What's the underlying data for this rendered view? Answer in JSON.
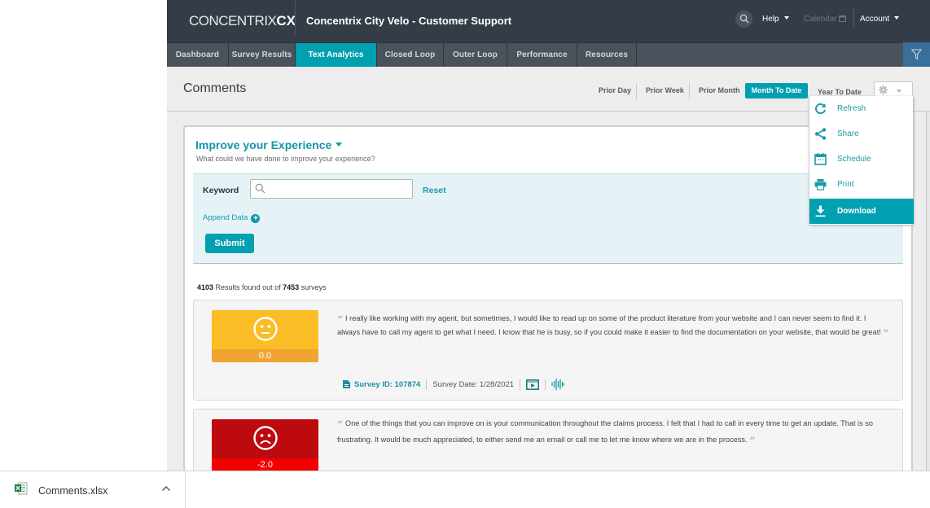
{
  "header": {
    "logo_main": "CONCENTRIX",
    "logo_suffix": "CX",
    "app_title": "Concentrix City Velo - Customer Support",
    "help_label": "Help",
    "calendar_label": "Calendar",
    "account_label": "Account"
  },
  "tabs": [
    {
      "label": "Dashboard",
      "active": false
    },
    {
      "label": "Survey Results",
      "active": false
    },
    {
      "label": "Text Analytics",
      "active": true
    },
    {
      "label": "Closed Loop",
      "active": false
    },
    {
      "label": "Outer Loop",
      "active": false
    },
    {
      "label": "Performance",
      "active": false
    },
    {
      "label": "Resources",
      "active": false
    }
  ],
  "page": {
    "title": "Comments",
    "periods": [
      {
        "label": "Prior Day",
        "active": false
      },
      {
        "label": "Prior Week",
        "active": false
      },
      {
        "label": "Prior Month",
        "active": false
      },
      {
        "label": "Month To Date",
        "active": true
      },
      {
        "label": "Year To Date",
        "active": false
      }
    ]
  },
  "settings_menu": {
    "items": [
      {
        "label": "Refresh",
        "icon": "refresh-icon",
        "active": false
      },
      {
        "label": "Share",
        "icon": "share-icon",
        "active": false
      },
      {
        "label": "Schedule",
        "icon": "calendar-icon",
        "active": false
      },
      {
        "label": "Print",
        "icon": "printer-icon",
        "active": false
      },
      {
        "label": "Download",
        "icon": "download-icon",
        "active": true
      }
    ]
  },
  "question": {
    "title": "Improve your Experience",
    "subtitle": "What could we have done to improve your experience?"
  },
  "filters": {
    "keyword_label": "Keyword",
    "keyword_value": "",
    "keyword_placeholder": "",
    "reset_label": "Reset",
    "append_label": "Append Data",
    "submit_label": "Submit"
  },
  "results": {
    "found": "4103",
    "found_text": " Results found out of ",
    "total": "7453",
    "total_text": " surveys"
  },
  "comments": [
    {
      "score": "0.0",
      "sentiment": "neutral",
      "face_color": "#fbbd26",
      "bar_color": "#f0a432",
      "text": "I really like working with my agent, but sometimes, I would like to read up on some of the product literature from your website and I can never seem to find it. I always have to call my agent to get what I need. I know that he is busy, so if you could make it easier to find the documentation on your website, that would be great!",
      "survey_id_label": "Survey ID: 107874",
      "survey_date_label": "Survey Date: 1/28/2021"
    },
    {
      "score": "-2.0",
      "sentiment": "negative",
      "face_color": "#bd0a0e",
      "bar_color": "#f50000",
      "text": "One of the things that you can improve on is your communication throughout the claims process. I felt that I had to call in every time to get an update. That is so frustrating. It would be much appreciated, to either send me an email or call me to let me know where we are in the process."
    }
  ],
  "download_bar": {
    "file_name": "Comments.xlsx"
  },
  "colors": {
    "accent": "#00a0b0",
    "header_bg": "#343d47",
    "tab_bg": "#4a525b",
    "filter_btn": "#3a6f9b"
  }
}
